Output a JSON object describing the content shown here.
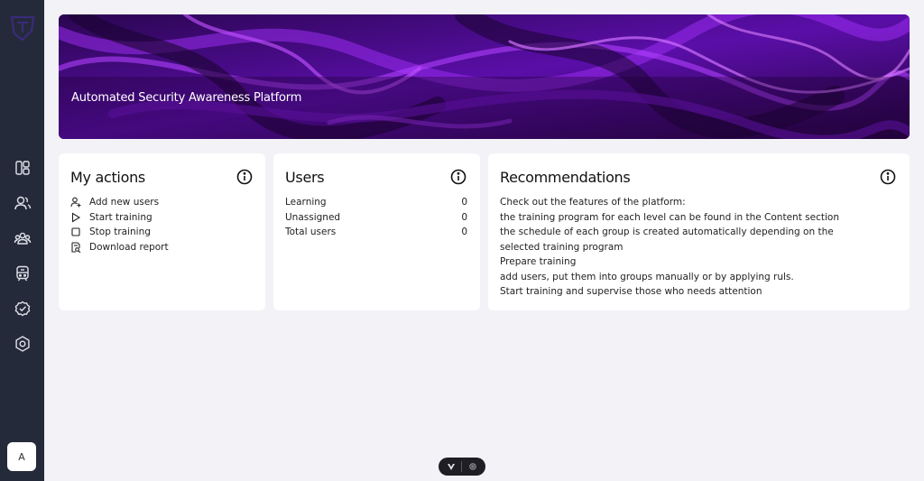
{
  "sidebar": {
    "items": [
      {
        "name": "dashboard-icon"
      },
      {
        "name": "users-icon"
      },
      {
        "name": "groups-icon"
      },
      {
        "name": "training-icon"
      },
      {
        "name": "verified-icon"
      },
      {
        "name": "settings-icon"
      }
    ],
    "avatar_label": "A"
  },
  "banner": {
    "title": "Automated Security Awareness Platform"
  },
  "my_actions": {
    "title": "My actions",
    "items": [
      {
        "label": "Add new users",
        "icon": "add-user-icon"
      },
      {
        "label": "Start training",
        "icon": "play-icon"
      },
      {
        "label": "Stop training",
        "icon": "stop-icon"
      },
      {
        "label": "Download report",
        "icon": "report-icon"
      }
    ]
  },
  "users": {
    "title": "Users",
    "rows": [
      {
        "label": "Learning",
        "value": "0"
      },
      {
        "label": "Unassigned",
        "value": "0"
      },
      {
        "label": "Total users",
        "value": "0"
      }
    ]
  },
  "recommendations": {
    "title": "Recommendations",
    "lines": [
      "Check out the features of the platform:",
      "the training program for each level can be found in the Content section",
      "the schedule of each group is created automatically depending on the selected training program",
      "Prepare training",
      "add users, put them into groups manually or by applying ruls.",
      "Start training and supervise those who needs attention"
    ]
  },
  "colors": {
    "sidebar_bg": "#252a3a",
    "page_bg": "#f2f2f7",
    "banner_accent": "#8a1ee0"
  }
}
